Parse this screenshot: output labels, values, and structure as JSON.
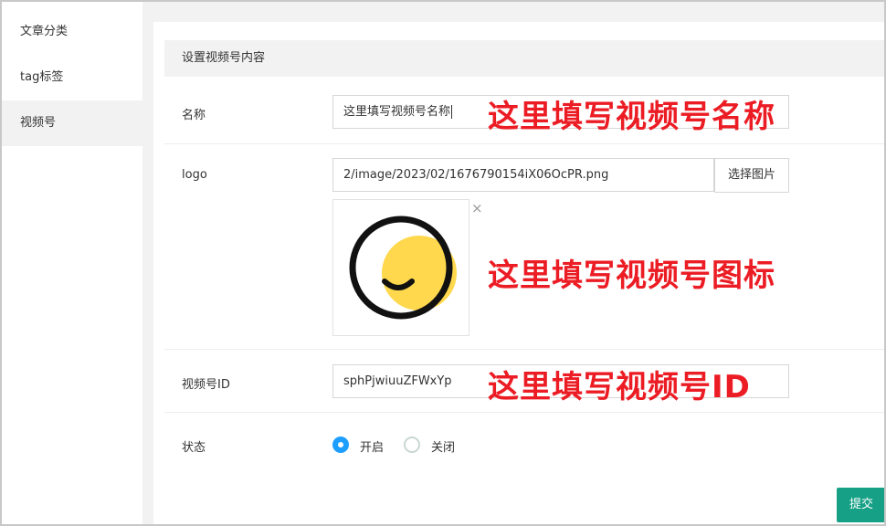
{
  "sidebar": {
    "items": [
      {
        "label": "文章分类"
      },
      {
        "label": "tag标签"
      },
      {
        "label": "视频号"
      }
    ]
  },
  "form": {
    "section_title": "设置视频号内容",
    "name_label": "名称",
    "name_value": "这里填写视频号名称",
    "logo_label": "logo",
    "logo_value": "2/image/2023/02/1676790154iX06OcPR.png",
    "pick_image_label": "选择图片",
    "remove_icon": "×",
    "id_label": "视频号ID",
    "id_value": "sphPjwiuuZFWxYp",
    "status_label": "状态",
    "status_options": [
      {
        "label": "开启",
        "selected": true
      },
      {
        "label": "关闭",
        "selected": false
      }
    ],
    "submit_label": "提交"
  },
  "annotations": {
    "name_note": "这里填写视频号名称",
    "logo_note": "这里填写视频号图标",
    "id_note": "这里填写视频号ID"
  },
  "colors": {
    "accent_blue": "#1e9fff",
    "submit_green": "#16a085",
    "annotation_red": "#ec1c24",
    "logo_yellow": "#ffd84d"
  }
}
